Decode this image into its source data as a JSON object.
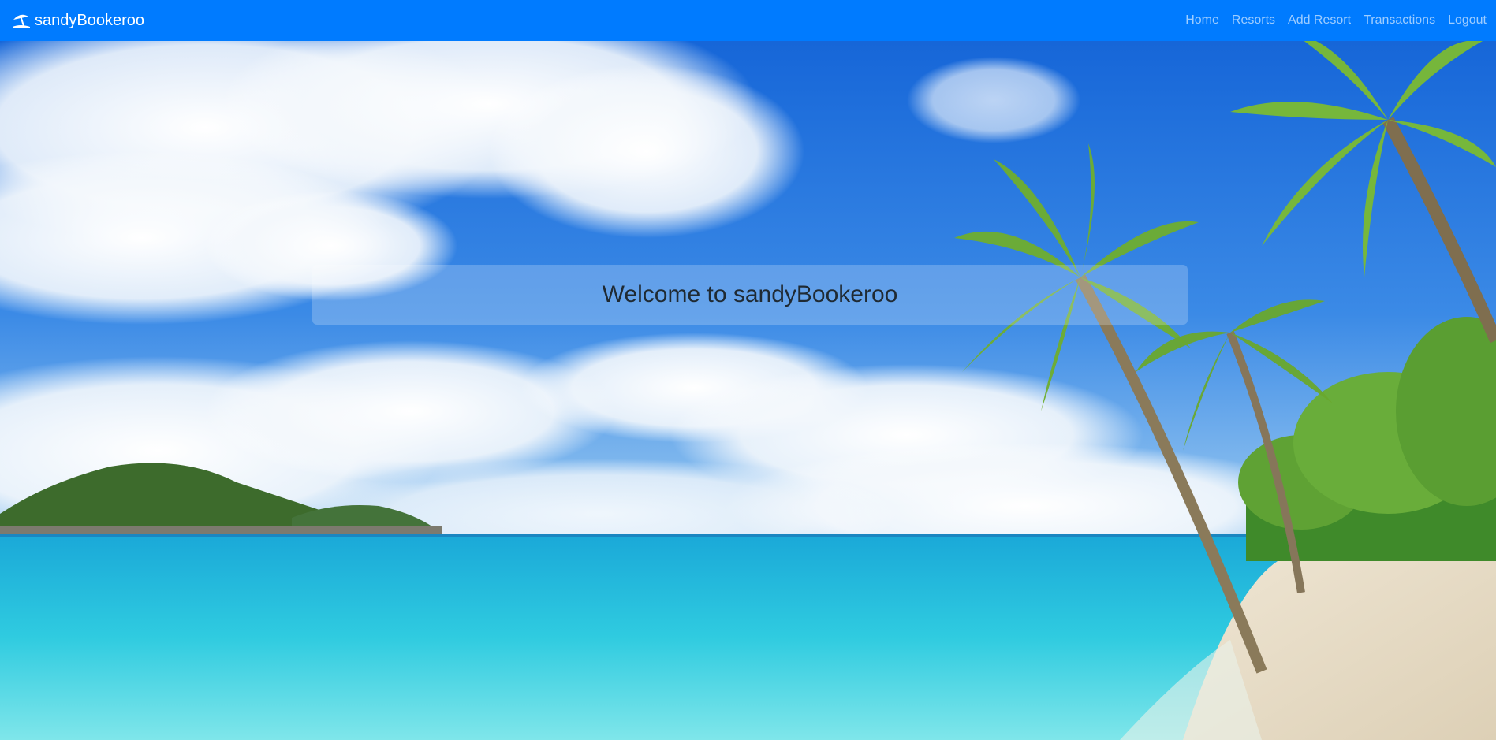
{
  "app": {
    "brand_name": "sandyBookeroo",
    "brand_icon": "beach-umbrella-icon"
  },
  "nav": {
    "items": [
      {
        "label": "Home"
      },
      {
        "label": "Resorts"
      },
      {
        "label": "Add Resort"
      },
      {
        "label": "Transactions"
      },
      {
        "label": "Logout"
      }
    ]
  },
  "hero": {
    "welcome_text": "Welcome to sandyBookeroo",
    "background": "tropical-beach-photo"
  },
  "colors": {
    "navbar": "#007bff",
    "nav_link": "rgba(255,255,255,0.62)",
    "brand_text": "#ffffff"
  }
}
